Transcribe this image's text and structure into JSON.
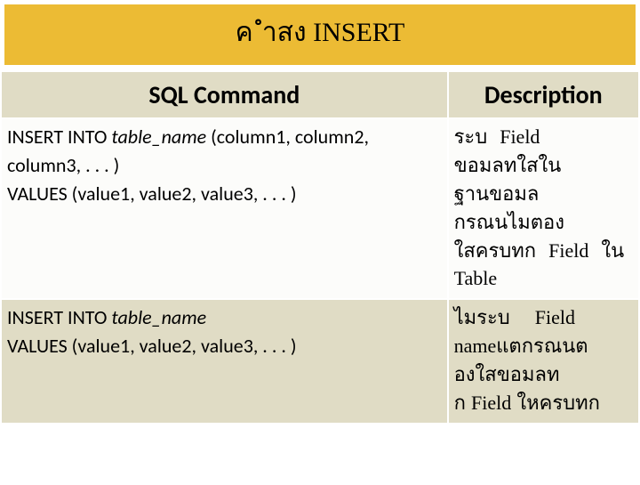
{
  "title": "ค ำสง      INSERT",
  "headers": {
    "col1": "SQL Command",
    "col2": "Description"
  },
  "rows": [
    {
      "sql_line1_a": "INSERT  INTO ",
      "sql_line1_tbl": "table_name",
      "sql_line1_b": " (column1, column2, column3, . . . )",
      "sql_line2": "VALUES (value1, value2, value3, . . . )",
      "desc_l1_a": "ระบ",
      "desc_l1_b": "Field",
      "desc_l2": "ขอมลทใสใน",
      "desc_l3": "ฐานขอมล",
      "desc_l4": "กรณนไมตอง",
      "desc_l5_a": "ใสครบทก",
      "desc_l5_b": "Field",
      "desc_l5_c": "ใน",
      "desc_l6": "Table"
    },
    {
      "sql_line1_a": "INSERT INTO ",
      "sql_line1_tbl": "table_name",
      "sql_line2": "VALUES (value1, value2, value3, . . . )",
      "desc_l1_a": "ไมระบ",
      "desc_l1_b": "Field",
      "desc_l2_a": "name",
      "desc_l2_b": "แตกรณนต",
      "desc_l3": "องใสขอมลท",
      "desc_l4_a": "ก ",
      "desc_l4_b": "Field",
      "desc_l4_c": " ใหครบทก"
    }
  ]
}
